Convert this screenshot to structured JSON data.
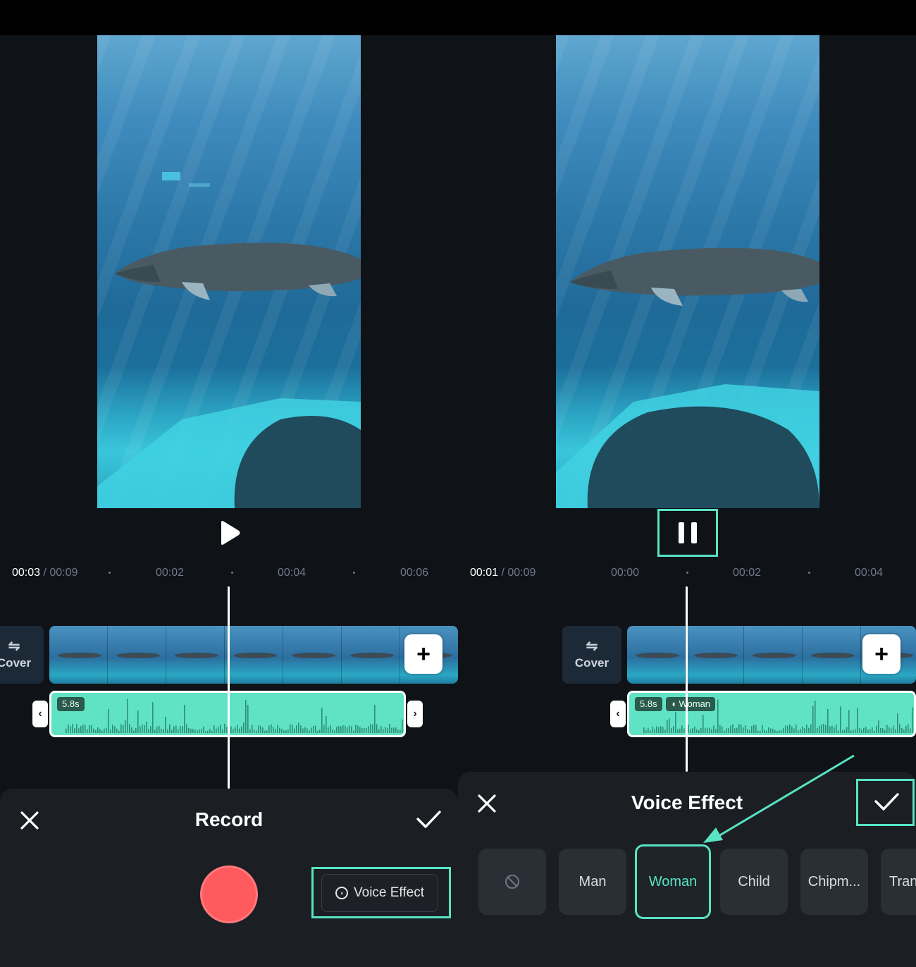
{
  "left": {
    "time": {
      "current": "00:03",
      "total": " / 00:09"
    },
    "ticks": [
      "00:02",
      "00:04",
      "00:06"
    ],
    "cover_label": "Cover",
    "audio_duration": "5.8s",
    "sheet": {
      "title": "Record",
      "voice_effect_label": "Voice Effect"
    }
  },
  "right": {
    "time": {
      "current": "00:01",
      "total": " / 00:09"
    },
    "ticks": [
      "00:00",
      "00:02",
      "00:04"
    ],
    "cover_label": "Cover",
    "audio_duration": "5.8s",
    "audio_effect_label": "Woman",
    "sheet": {
      "title": "Voice Effect"
    },
    "effects": [
      "Man",
      "Woman",
      "Child",
      "Chipm...",
      "Tran"
    ],
    "selected_effect": "Woman"
  },
  "colors": {
    "accent": "#57e3c4",
    "audio_clip": "#5fe3c4",
    "record": "#ff5a5e",
    "background": "#0f1216"
  },
  "icons": [
    "play-icon",
    "pause-icon",
    "swap-icon",
    "plus-icon",
    "close-icon",
    "check-icon",
    "voice-effect-icon",
    "none-icon"
  ]
}
